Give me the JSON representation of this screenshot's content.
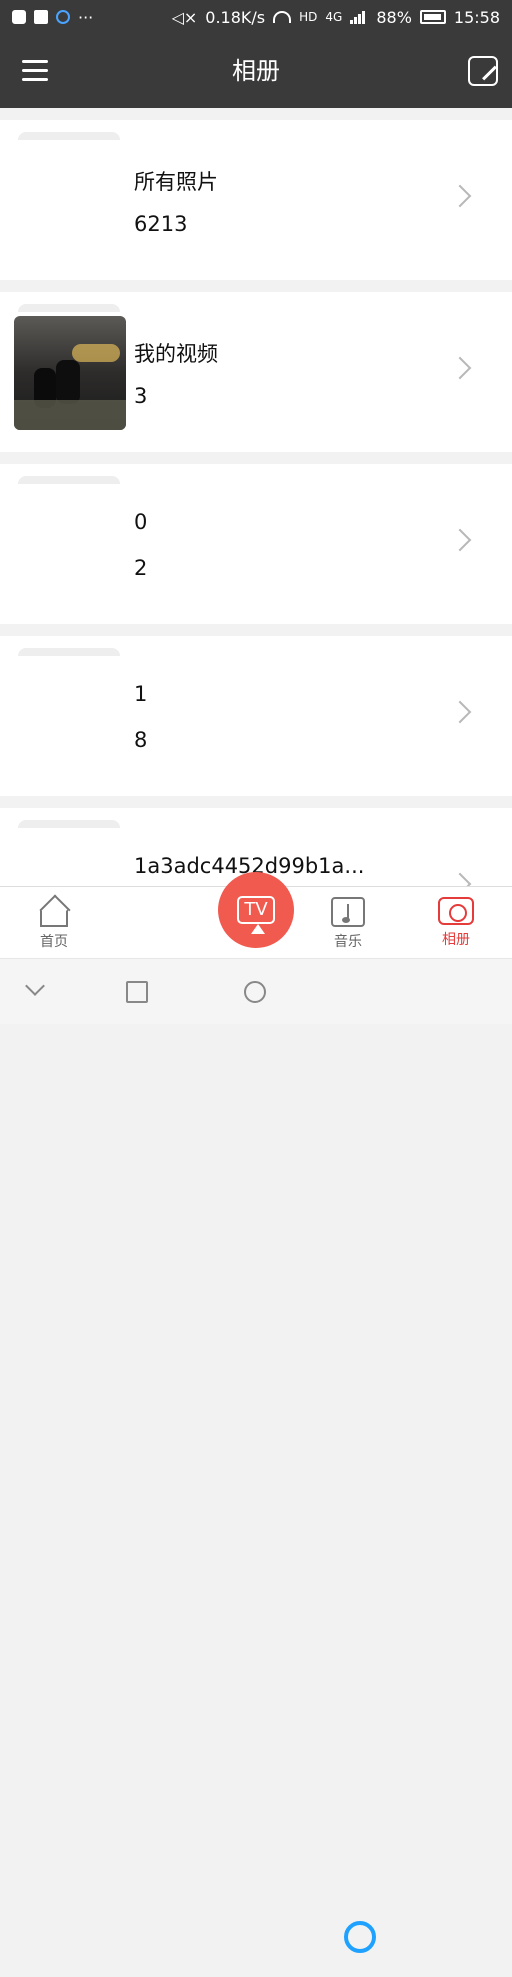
{
  "status": {
    "speed": "0.18K/s",
    "network": "HD",
    "network_gen": "4G",
    "battery": "88%",
    "time": "15:58"
  },
  "header": {
    "title": "相册"
  },
  "albums": [
    {
      "name": "所有照片",
      "count": "6213"
    },
    {
      "name": "我的视频",
      "count": "3"
    },
    {
      "name": "0",
      "count": "2"
    },
    {
      "name": "1",
      "count": "8"
    },
    {
      "name": "1a3adc4452d99b1a..."
    }
  ],
  "bottom_nav": {
    "home": "首页",
    "tv": "TV",
    "music": "音乐",
    "album": "相册"
  }
}
